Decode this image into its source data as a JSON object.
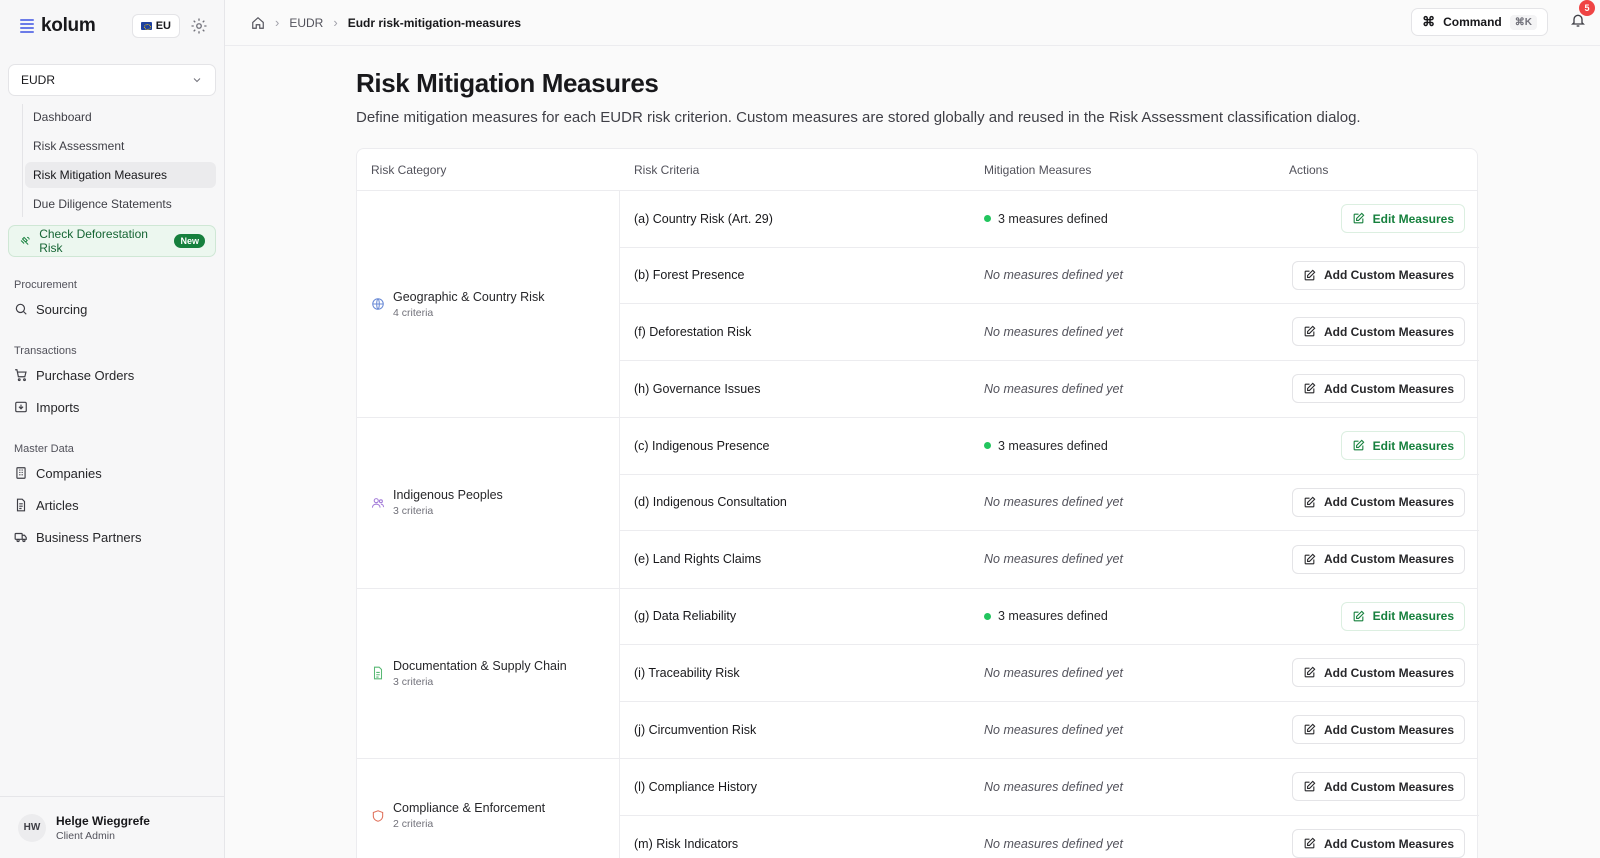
{
  "sidebar": {
    "logo": "kolum",
    "region": "EU",
    "workspace": "EUDR",
    "sub_items": [
      {
        "label": "Dashboard"
      },
      {
        "label": "Risk Assessment"
      },
      {
        "label": "Risk Mitigation Measures",
        "active": true
      },
      {
        "label": "Due Diligence Statements"
      }
    ],
    "promo": {
      "label": "Check Deforestation Risk",
      "badge": "New"
    },
    "sections": [
      {
        "label": "Procurement",
        "items": [
          {
            "label": "Sourcing",
            "icon": "search-icon"
          }
        ]
      },
      {
        "label": "Transactions",
        "items": [
          {
            "label": "Purchase Orders",
            "icon": "cart-icon"
          },
          {
            "label": "Imports",
            "icon": "import-icon"
          }
        ]
      },
      {
        "label": "Master Data",
        "items": [
          {
            "label": "Companies",
            "icon": "building-icon"
          },
          {
            "label": "Articles",
            "icon": "document-icon"
          },
          {
            "label": "Business Partners",
            "icon": "truck-icon"
          }
        ]
      }
    ],
    "user": {
      "initials": "HW",
      "name": "Helge Wieggrefe",
      "role": "Client Admin"
    }
  },
  "topbar": {
    "breadcrumb": [
      "EUDR",
      "Eudr risk-mitigation-measures"
    ],
    "command_label": "Command",
    "command_shortcut": "⌘K",
    "notification_count": "5"
  },
  "page": {
    "title": "Risk Mitigation Measures",
    "description": "Define mitigation measures for each EUDR risk criterion. Custom measures are stored globally and reused in the Risk Assessment classification dialog."
  },
  "table": {
    "headers": [
      "Risk Category",
      "Risk Criteria",
      "Mitigation Measures",
      "Actions"
    ],
    "groups": [
      {
        "name": "Geographic & Country Risk",
        "count": "4 criteria",
        "icon": "globe-icon",
        "color": "#6b8bd6",
        "rows": [
          {
            "criteria": "(a) Country Risk (Art. 29)",
            "measures": "3 measures defined",
            "defined": true,
            "action": "Edit Measures"
          },
          {
            "criteria": "(b) Forest Presence",
            "measures": "No measures defined yet",
            "defined": false,
            "action": "Add Custom Measures"
          },
          {
            "criteria": "(f) Deforestation Risk",
            "measures": "No measures defined yet",
            "defined": false,
            "action": "Add Custom Measures"
          },
          {
            "criteria": "(h) Governance Issues",
            "measures": "No measures defined yet",
            "defined": false,
            "action": "Add Custom Measures"
          }
        ]
      },
      {
        "name": "Indigenous Peoples",
        "count": "3 criteria",
        "icon": "users-icon",
        "color": "#a27ad8",
        "rows": [
          {
            "criteria": "(c) Indigenous Presence",
            "measures": "3 measures defined",
            "defined": true,
            "action": "Edit Measures"
          },
          {
            "criteria": "(d) Indigenous Consultation",
            "measures": "No measures defined yet",
            "defined": false,
            "action": "Add Custom Measures"
          },
          {
            "criteria": "(e) Land Rights Claims",
            "measures": "No measures defined yet",
            "defined": false,
            "action": "Add Custom Measures"
          }
        ]
      },
      {
        "name": "Documentation & Supply Chain",
        "count": "3 criteria",
        "icon": "file-icon",
        "color": "#58b874",
        "rows": [
          {
            "criteria": "(g) Data Reliability",
            "measures": "3 measures defined",
            "defined": true,
            "action": "Edit Measures"
          },
          {
            "criteria": "(i) Traceability Risk",
            "measures": "No measures defined yet",
            "defined": false,
            "action": "Add Custom Measures"
          },
          {
            "criteria": "(j) Circumvention Risk",
            "measures": "No measures defined yet",
            "defined": false,
            "action": "Add Custom Measures"
          }
        ]
      },
      {
        "name": "Compliance & Enforcement",
        "count": "2 criteria",
        "icon": "shield-icon",
        "color": "#e0705a",
        "rows": [
          {
            "criteria": "(l) Compliance History",
            "measures": "No measures defined yet",
            "defined": false,
            "action": "Add Custom Measures"
          },
          {
            "criteria": "(m) Risk Indicators",
            "measures": "No measures defined yet",
            "defined": false,
            "action": "Add Custom Measures"
          }
        ]
      }
    ]
  }
}
